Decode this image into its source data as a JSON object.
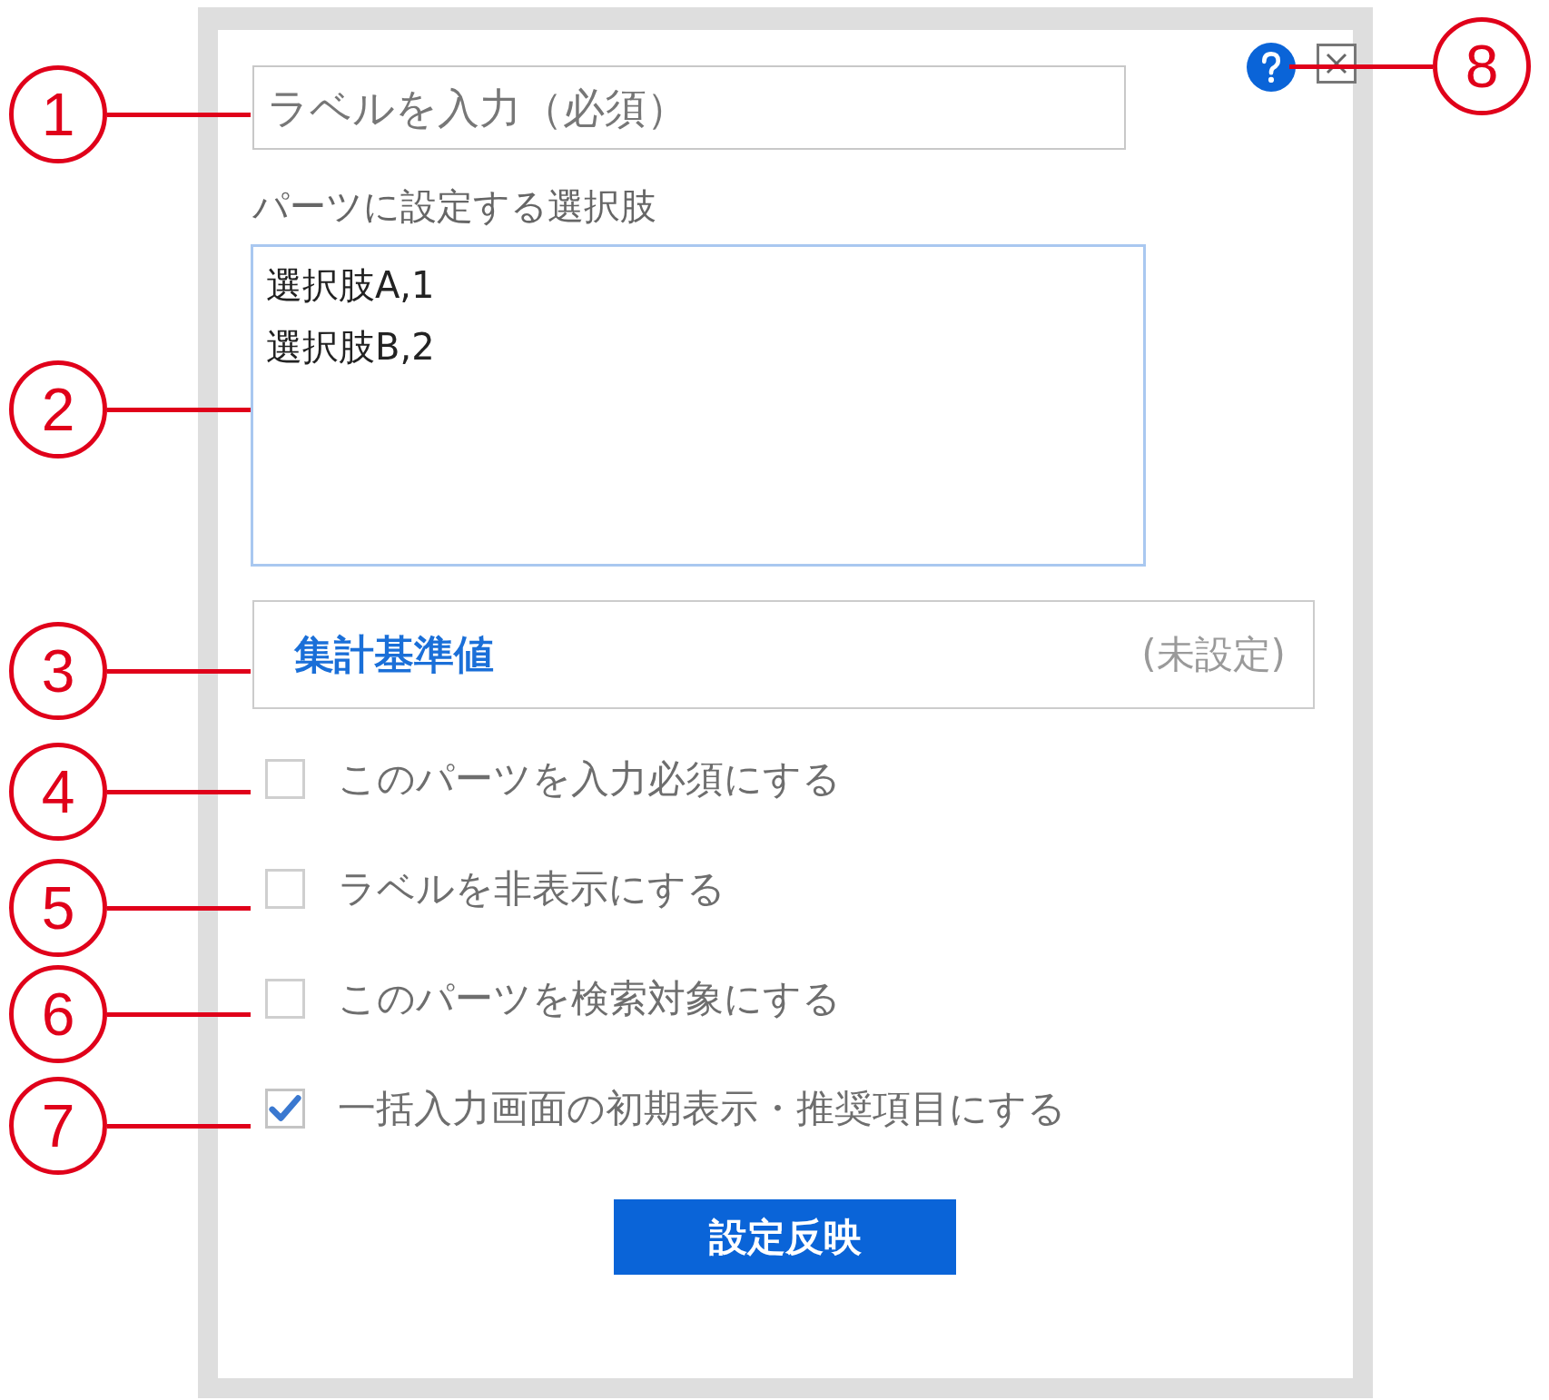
{
  "label_field": {
    "placeholder": "ラベルを入力（必須）"
  },
  "choices_caption": "パーツに設定する選択肢",
  "choices_field": {
    "value": "選択肢A,1\n選択肢B,2"
  },
  "aggregate": {
    "label": "集計基準値",
    "value": "(未設定)"
  },
  "options": [
    {
      "label": "このパーツを入力必須にする",
      "checked": false
    },
    {
      "label": "ラベルを非表示にする",
      "checked": false
    },
    {
      "label": "このパーツを検索対象にする",
      "checked": false
    },
    {
      "label": "一括入力画面の初期表示・推奨項目にする",
      "checked": true
    }
  ],
  "apply_button": "設定反映",
  "callouts": [
    "1",
    "2",
    "3",
    "4",
    "5",
    "6",
    "7",
    "8"
  ]
}
